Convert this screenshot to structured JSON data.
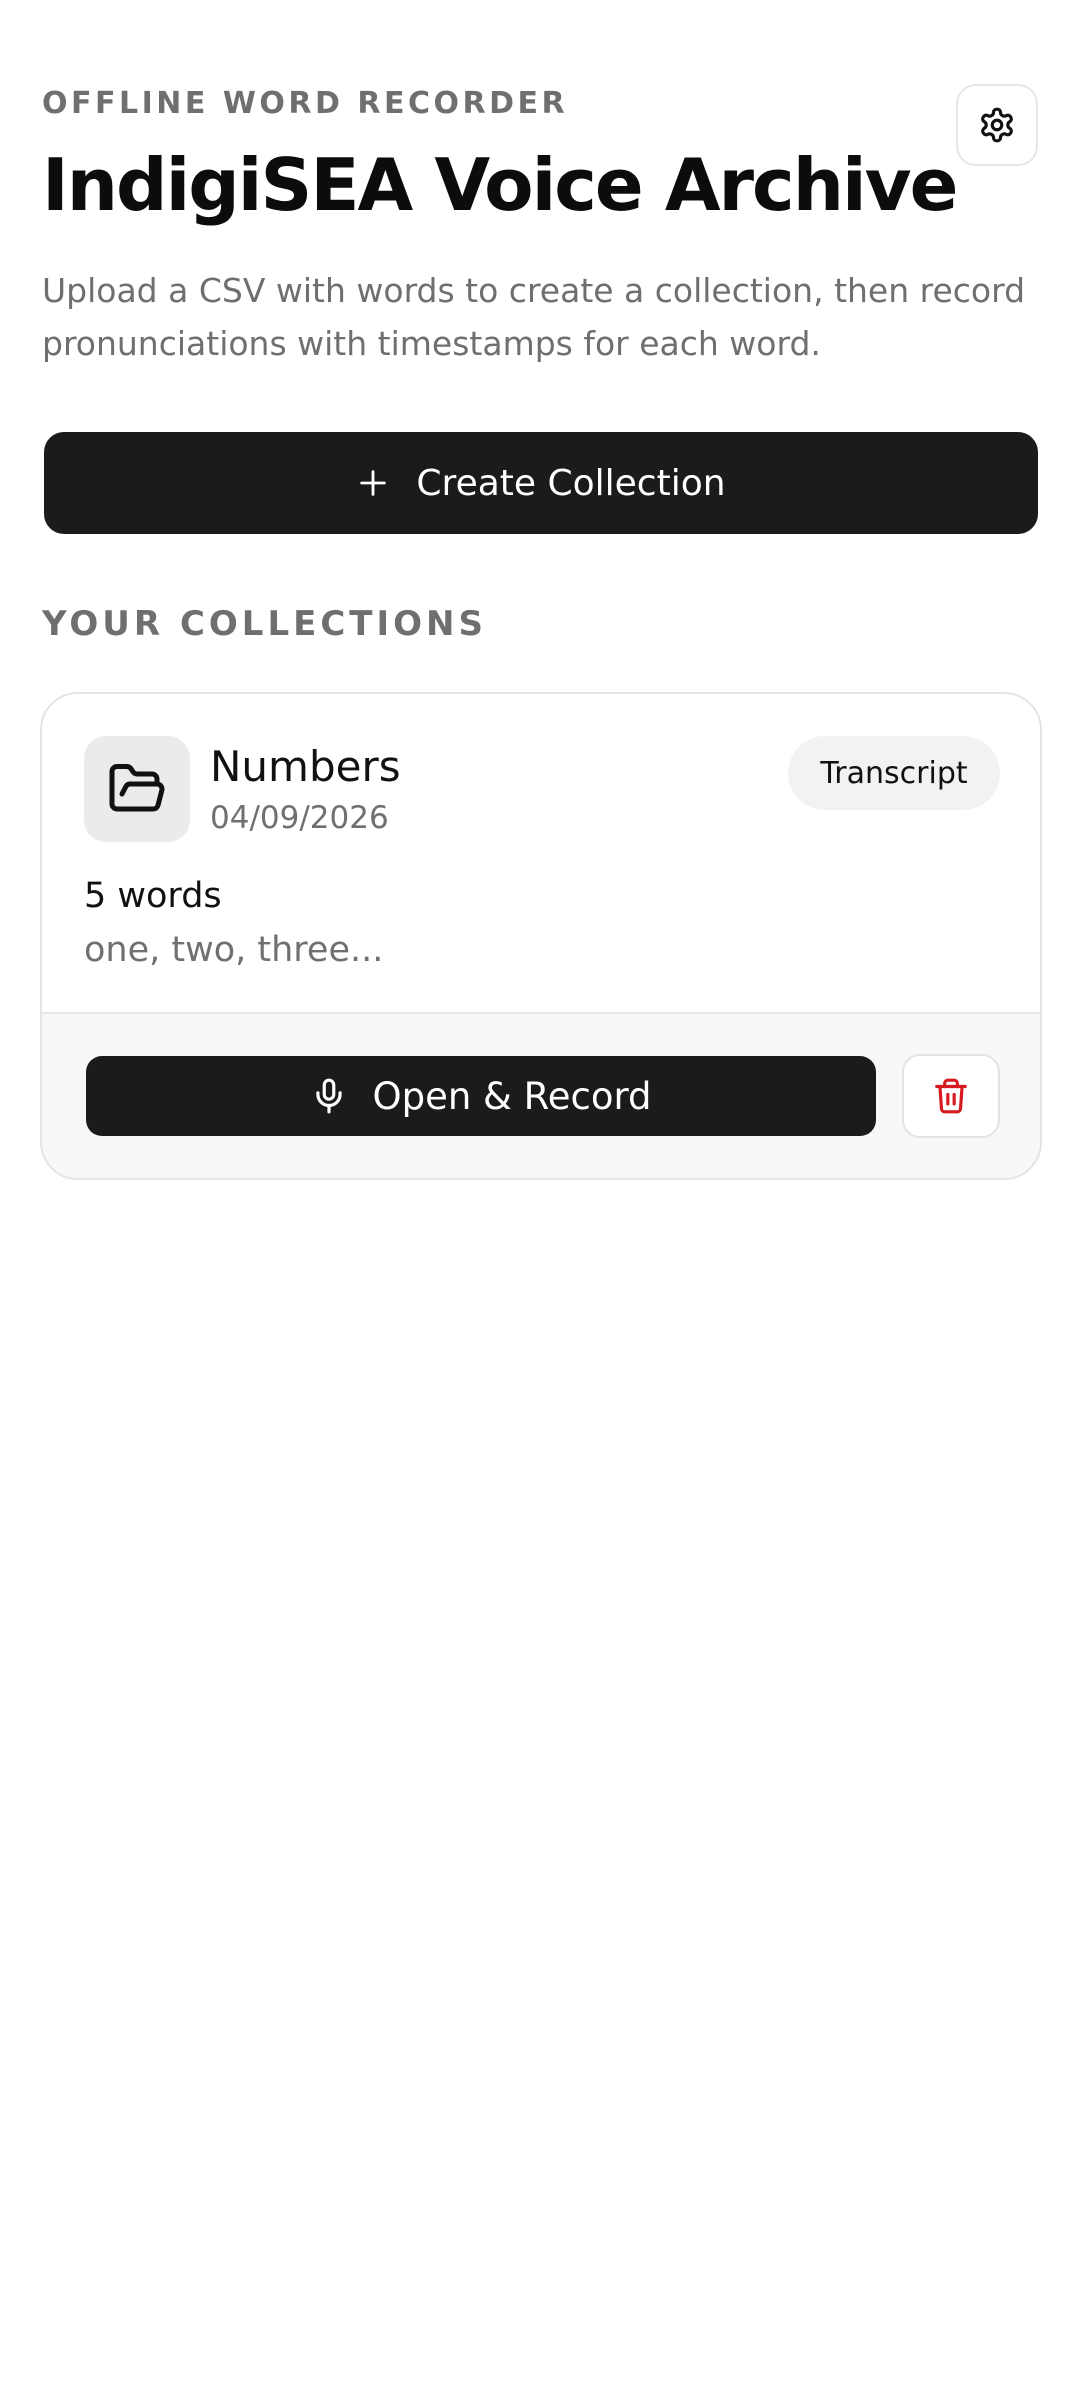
{
  "header": {
    "eyebrow": "OFFLINE WORD RECORDER",
    "title": "IndigiSEA Voice Archive",
    "subtitle": "Upload a CSV with words to create a collection, then record pronunciations with timestamps for each word.",
    "settings_icon": "gear-icon"
  },
  "actions": {
    "create_label": "Create Collection",
    "create_icon": "plus-icon"
  },
  "collections": {
    "section_label": "YOUR COLLECTIONS",
    "items": [
      {
        "name": "Numbers",
        "date": "04/09/2026",
        "badge_label": "Transcript",
        "word_count": "5 words",
        "preview": "one, two, three...",
        "record_label": "Open & Record",
        "icons": [
          "folder-open-icon",
          "microphone-icon",
          "trash-icon"
        ]
      }
    ]
  },
  "colors": {
    "primary": "#1b1b1b",
    "muted_text": "#6f6f6f",
    "danger": "#d71920",
    "card_border": "#e4e4e4",
    "badge_bg": "#f2f2f2"
  }
}
